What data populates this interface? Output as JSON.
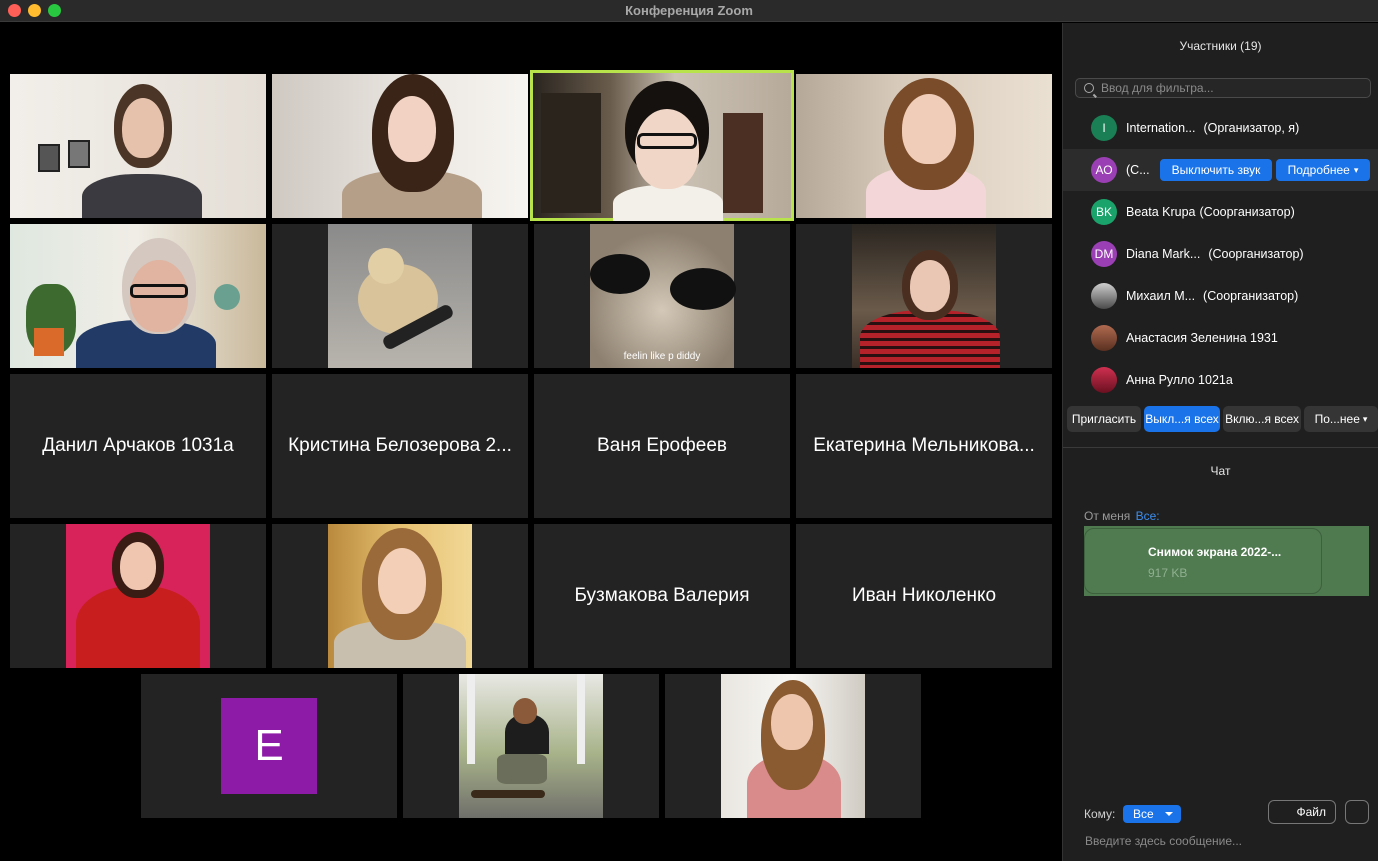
{
  "window": {
    "title": "Конференция Zoom"
  },
  "gallery": {
    "name_tiles": [
      "Данил Арчаков 1031а",
      "Кристина Белозерова 2...",
      "Ваня Ерофеев",
      "Екатерина Мельникова...",
      "Бузмакова Валерия",
      "Иван Николенко"
    ],
    "caption_cat": "feelin like p diddy",
    "avatar_letter": "E",
    "active_speaker_color": "#b8e34a"
  },
  "sidebar": {
    "title": "Участники (19)",
    "filter_placeholder": "Ввод для фильтра...",
    "participants": [
      {
        "initials": "I",
        "color": "#1a7f54",
        "name": "Internation...",
        "role": "(Организатор, я)"
      },
      {
        "initials": "АО",
        "color": "#9b3fb5",
        "name": "(С...",
        "role": ""
      },
      {
        "initials": "BK",
        "color": "#1aa36b",
        "name": "Beata Krupa",
        "role": "(Соорганизатор)"
      },
      {
        "initials": "DM",
        "color": "#9b3fb5",
        "name": "Diana Mark...",
        "role": "(Соорганизатор)"
      },
      {
        "initials": "",
        "color": "#6a6a6a",
        "name": "Михаил М...",
        "role": "(Соорганизатор)"
      },
      {
        "initials": "",
        "color": "#8a5a4a",
        "name": "Анастасия Зеленина 1931",
        "role": ""
      },
      {
        "initials": "",
        "color": "#b0304a",
        "name": "Анна Рулло 1021а",
        "role": ""
      }
    ],
    "mute_button": "Выключить звук",
    "more_button": "Подробнее",
    "actions": {
      "invite": "Пригласить",
      "mute_all": "Выкл...я всех",
      "unmute_all": "Вклю...я всех",
      "more": "По...нее"
    },
    "chat": {
      "title": "Чат",
      "from": "От меня",
      "to": "Все:",
      "file_name": "Снимок экрана 2022-...",
      "file_size": "917 KB",
      "to_label": "Кому:",
      "to_value": "Все",
      "file_button": "Файл",
      "message_placeholder": "Введите здесь сообщение..."
    }
  }
}
